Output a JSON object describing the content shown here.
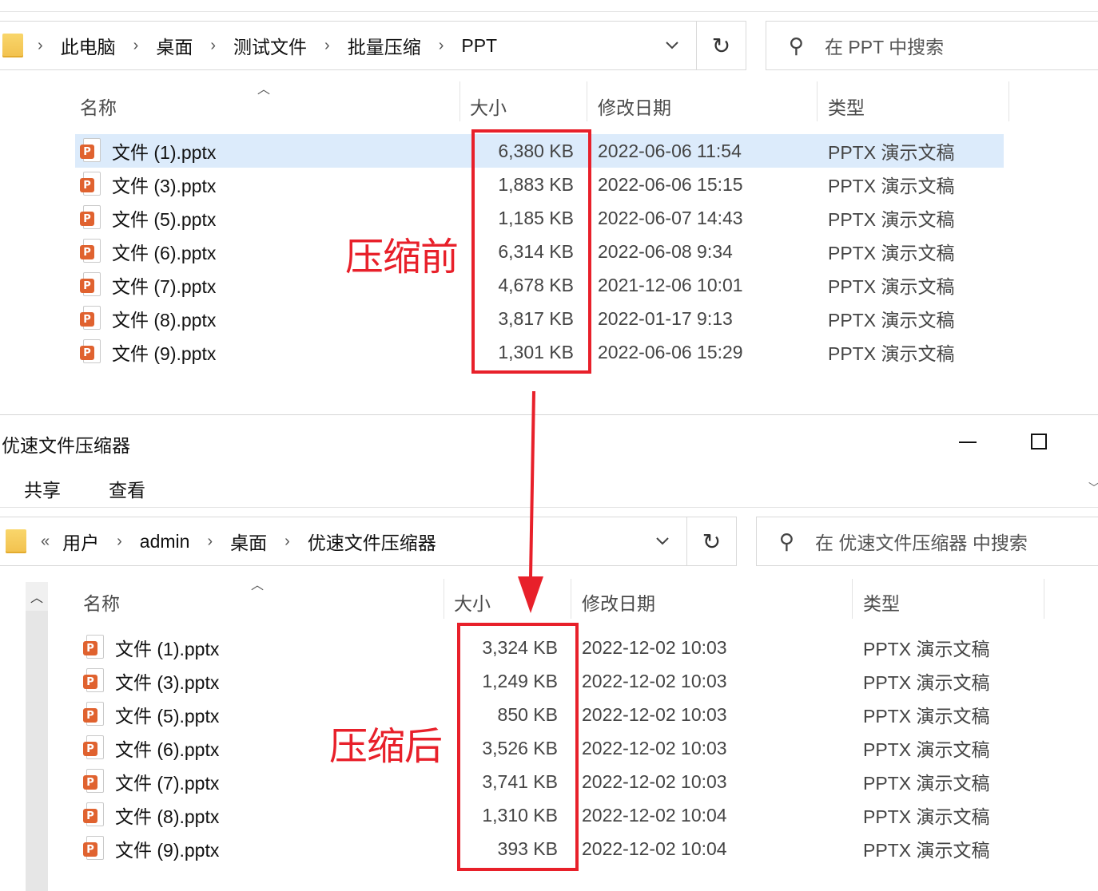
{
  "top": {
    "breadcrumb": [
      "此电脑",
      "桌面",
      "测试文件",
      "批量压缩",
      "PPT"
    ],
    "breadcrumb_sep": "›",
    "search_placeholder": "在 PPT 中搜索",
    "columns": {
      "name": "名称",
      "size": "大小",
      "date": "修改日期",
      "type": "类型"
    },
    "label": "压缩前",
    "rows": [
      {
        "name": "文件 (1).pptx",
        "size": "6,380 KB",
        "date": "2022-06-06 11:54",
        "type": "PPTX 演示文稿",
        "selected": true
      },
      {
        "name": "文件 (3).pptx",
        "size": "1,883 KB",
        "date": "2022-06-06 15:15",
        "type": "PPTX 演示文稿"
      },
      {
        "name": "文件 (5).pptx",
        "size": "1,185 KB",
        "date": "2022-06-07 14:43",
        "type": "PPTX 演示文稿"
      },
      {
        "name": "文件 (6).pptx",
        "size": "6,314 KB",
        "date": "2022-06-08 9:34",
        "type": "PPTX 演示文稿"
      },
      {
        "name": "文件 (7).pptx",
        "size": "4,678 KB",
        "date": "2021-12-06 10:01",
        "type": "PPTX 演示文稿"
      },
      {
        "name": "文件 (8).pptx",
        "size": "3,817 KB",
        "date": "2022-01-17 9:13",
        "type": "PPTX 演示文稿"
      },
      {
        "name": "文件 (9).pptx",
        "size": "1,301 KB",
        "date": "2022-06-06 15:29",
        "type": "PPTX 演示文稿"
      }
    ]
  },
  "bottom": {
    "window_title": "优速文件压缩器",
    "menu": [
      "共享",
      "查看"
    ],
    "breadcrumb_overflow": "«",
    "breadcrumb": [
      "用户",
      "admin",
      "桌面",
      "优速文件压缩器"
    ],
    "breadcrumb_sep": "›",
    "search_placeholder": "在 优速文件压缩器 中搜索",
    "columns": {
      "name": "名称",
      "size": "大小",
      "date": "修改日期",
      "type": "类型"
    },
    "label": "压缩后",
    "rows": [
      {
        "name": "文件 (1).pptx",
        "size": "3,324 KB",
        "date": "2022-12-02 10:03",
        "type": "PPTX 演示文稿"
      },
      {
        "name": "文件 (3).pptx",
        "size": "1,249 KB",
        "date": "2022-12-02 10:03",
        "type": "PPTX 演示文稿"
      },
      {
        "name": "文件 (5).pptx",
        "size": "850 KB",
        "date": "2022-12-02 10:03",
        "type": "PPTX 演示文稿"
      },
      {
        "name": "文件 (6).pptx",
        "size": "3,526 KB",
        "date": "2022-12-02 10:03",
        "type": "PPTX 演示文稿"
      },
      {
        "name": "文件 (7).pptx",
        "size": "3,741 KB",
        "date": "2022-12-02 10:03",
        "type": "PPTX 演示文稿"
      },
      {
        "name": "文件 (8).pptx",
        "size": "1,310 KB",
        "date": "2022-12-02 10:04",
        "type": "PPTX 演示文稿"
      },
      {
        "name": "文件 (9).pptx",
        "size": "393 KB",
        "date": "2022-12-02 10:04",
        "type": "PPTX 演示文稿"
      }
    ]
  },
  "icons": {
    "folder": "folder-icon",
    "chevron": "chevron-down-icon",
    "refresh": "refresh-icon",
    "search": "search-icon",
    "file": "pptx-file-icon",
    "minimize": "minimize-icon",
    "maximize": "maximize-icon",
    "sort": "sort-ascending-icon",
    "arrow": "down-arrow-icon"
  },
  "colors": {
    "highlight": "#e8202a",
    "selection": "#dcebfb",
    "folder": "#f2c14e",
    "ppt": "#e0622f"
  }
}
